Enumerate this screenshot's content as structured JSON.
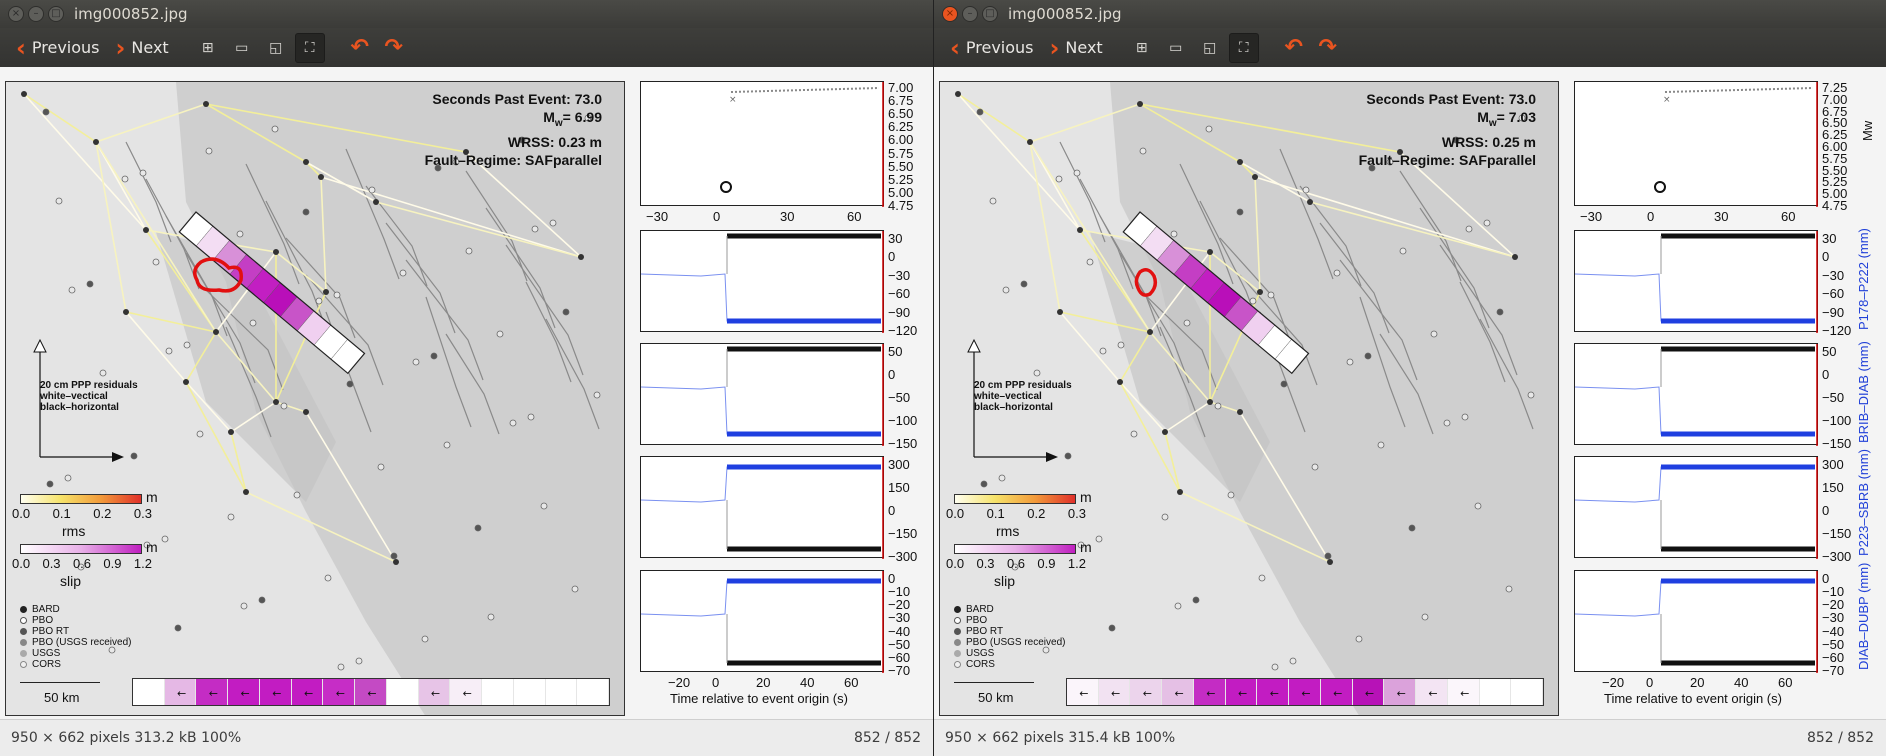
{
  "windows": [
    {
      "title": "img000852.jpg",
      "prev": "Previous",
      "next": "Next",
      "status_info": "950 × 662 pixels  313.2 kB   100%",
      "status_count": "852 / 852",
      "figure": {
        "seconds": "Seconds Past Event: 73.0",
        "mw_prefix": "M",
        "mw_sub": "w",
        "mw_value": "= 6.99",
        "wrss": "WRSS: 0.23 m",
        "fault": "Fault–Regime: SAFparallel",
        "mw_ticks": [
          "7.00",
          "6.75",
          "6.50",
          "6.25",
          "6.00",
          "5.75",
          "5.50",
          "5.25",
          "5.00",
          "4.75"
        ],
        "mw_axis_label": "",
        "top_xticks": [
          "−30",
          "0",
          "30",
          "60"
        ],
        "p1_ticks": [
          "30",
          "0",
          "−30",
          "−60",
          "−90",
          "−120"
        ],
        "p1_label": "",
        "p2_ticks": [
          "50",
          "0",
          "−50",
          "−100",
          "−150"
        ],
        "p2_label": "",
        "p3_ticks": [
          "300",
          "150",
          "0",
          "−150",
          "−300"
        ],
        "p3_label": "",
        "p4_ticks": [
          "0",
          "−10",
          "−20",
          "−30",
          "−40",
          "−50",
          "−60",
          "−70"
        ],
        "p4_label": "",
        "bottom_xticks": [
          "−20",
          "0",
          "20",
          "40",
          "60"
        ]
      }
    },
    {
      "title": "img000852.jpg",
      "prev": "Previous",
      "next": "Next",
      "status_info": "950 × 662 pixels  315.4 kB   100%",
      "status_count": "852 / 852",
      "figure": {
        "seconds": "Seconds Past Event: 73.0",
        "mw_prefix": "M",
        "mw_sub": "w",
        "mw_value": "= 7.03",
        "wrss": "WRSS: 0.25 m",
        "fault": "Fault–Regime: SAFparallel",
        "mw_ticks": [
          "7.25",
          "7.00",
          "6.75",
          "6.50",
          "6.25",
          "6.00",
          "5.75",
          "5.50",
          "5.25",
          "5.00",
          "4.75"
        ],
        "mw_axis_label": "Mw",
        "top_xticks": [
          "−30",
          "0",
          "30",
          "60"
        ],
        "p1_ticks": [
          "30",
          "0",
          "−30",
          "−60",
          "−90",
          "−120"
        ],
        "p1_label": "P178–P222 (mm)",
        "p2_ticks": [
          "50",
          "0",
          "−50",
          "−100",
          "−150"
        ],
        "p2_label": "BRIB–DIAB (mm)",
        "p3_ticks": [
          "300",
          "150",
          "0",
          "−150",
          "−300"
        ],
        "p3_label": "P223–SBRB (mm)",
        "p4_ticks": [
          "0",
          "−10",
          "−20",
          "−30",
          "−40",
          "−50",
          "−60",
          "−70"
        ],
        "p4_label": "DIAB–DUBP (mm)",
        "bottom_xticks": [
          "−20",
          "0",
          "20",
          "40",
          "60"
        ]
      }
    }
  ],
  "map_common": {
    "resid_text": [
      "20 cm PPP residuals",
      "white–vectical",
      "black–horizontal"
    ],
    "rms_unit": "m",
    "rms_ticks": [
      "0.0",
      "0.1",
      "0.2",
      "0.3"
    ],
    "rms_label": "rms",
    "slip_unit": "m",
    "slip_ticks": [
      "0.0",
      "0.3",
      "0.6",
      "0.9",
      "1.2"
    ],
    "slip_label": "slip",
    "legend": [
      "BARD",
      "PBO",
      "PBO RT",
      "PBO (USGS received)",
      "USGS",
      "CORS"
    ],
    "scale_km": "50 km",
    "xlabel": "Time relative to event origin (s)"
  },
  "colors": {
    "accent": "#e95420",
    "slip": "#c020c0",
    "rms_hot": "#e03020",
    "series_blue": "#1f3fe0"
  }
}
